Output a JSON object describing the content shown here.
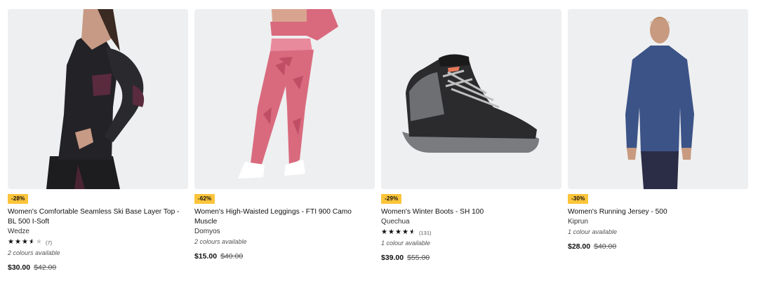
{
  "products": [
    {
      "badge": "-28%",
      "title": "Women's Comfortable Seamless Ski Base Layer Top - BL 500 I-Soft",
      "brand": "Wedze",
      "rating": 3.5,
      "review_count": "(7)",
      "colours": "2 colours available",
      "price": "$30.00",
      "old_price": "$42.00",
      "image": "black-base-layer-top"
    },
    {
      "badge": "-62%",
      "title": "Women's High-Waisted Leggings - FTI 900 Camo Muscle",
      "brand": "Domyos",
      "colours": "2 colours available",
      "price": "$15.00",
      "old_price": "$40.00",
      "image": "pink-camo-leggings"
    },
    {
      "badge": "-29%",
      "title": "Women's Winter Boots - SH  100",
      "brand": "Quechua",
      "rating": 4.5,
      "review_count": "(131)",
      "colours": "1 colour available",
      "price": "$39.00",
      "old_price": "$55.00",
      "image": "black-winter-boot"
    },
    {
      "badge": "-30%",
      "title": "Women's Running Jersey - 500",
      "brand": "Kiprun",
      "colours": "1 colour available",
      "price": "$28.00",
      "old_price": "$40.00",
      "image": "blue-running-jersey"
    }
  ],
  "colors": {
    "badge": "#fbc43a",
    "image_bg": "#eeeff0",
    "text": "#101010"
  }
}
